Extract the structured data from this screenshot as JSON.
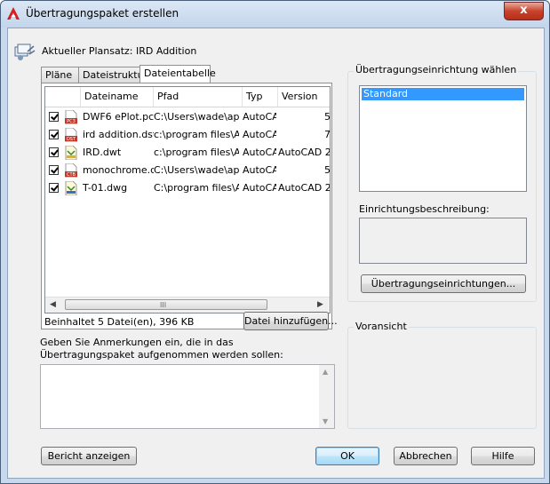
{
  "window": {
    "title": "Übertragungspaket erstellen",
    "close_label": "x"
  },
  "current_set": {
    "label": "Aktueller Plansatz: IRD Addition"
  },
  "tabs": [
    {
      "label": "Pläne"
    },
    {
      "label": "Dateistruktur"
    },
    {
      "label": "Dateientabelle"
    }
  ],
  "table": {
    "columns": [
      "Dateiname",
      "Pfad",
      "Typ",
      "Version"
    ],
    "rows": [
      {
        "name": "DWF6 ePlot.pc3",
        "path": "C:\\Users\\wade\\app",
        "type": "AutoCA",
        "version": "",
        "extra": "5",
        "icon": "pc3-file-icon"
      },
      {
        "name": "ird addition.dst",
        "path": "c:\\program files\\Aut",
        "type": "AutoCA",
        "version": "",
        "extra": "7",
        "icon": "dst-file-icon"
      },
      {
        "name": "IRD.dwt",
        "path": "c:\\program files\\Aut",
        "type": "AutoCA",
        "version": "AutoCAD 2",
        "extra": "",
        "icon": "dwt-file-icon"
      },
      {
        "name": "monochrome.ctb",
        "path": "C:\\Users\\wade\\app",
        "type": "AutoCA",
        "version": "",
        "extra": "5",
        "icon": "ctb-file-icon"
      },
      {
        "name": "T-01.dwg",
        "path": "C:\\program files\\Aut",
        "type": "AutoCA",
        "version": "AutoCAD 2",
        "extra": "",
        "icon": "dwg-file-icon"
      }
    ],
    "scroll_grip": "III"
  },
  "summary": "Beinhaltet 5 Datei(en), 396 KB",
  "add_file_button": "Datei hinzufügen...",
  "notes": {
    "label": "Geben Sie Anmerkungen ein, die in das Übertragungspaket aufgenommen werden sollen:",
    "value": ""
  },
  "setup": {
    "title": "Übertragungseinrichtung wählen",
    "items": [
      "Standard"
    ],
    "selected": "Standard",
    "description_label": "Einrichtungsbeschreibung:",
    "description_value": "",
    "setups_button": "Übertragungseinrichtungen..."
  },
  "preview": {
    "title": "Voransicht"
  },
  "buttons": {
    "report": "Bericht anzeigen",
    "ok": "OK",
    "cancel": "Abbrechen",
    "help": "Hilfe"
  },
  "colors": {
    "selection": "#3399ff",
    "close_button": "#c7432d",
    "pdf_red": "#c0392b"
  }
}
